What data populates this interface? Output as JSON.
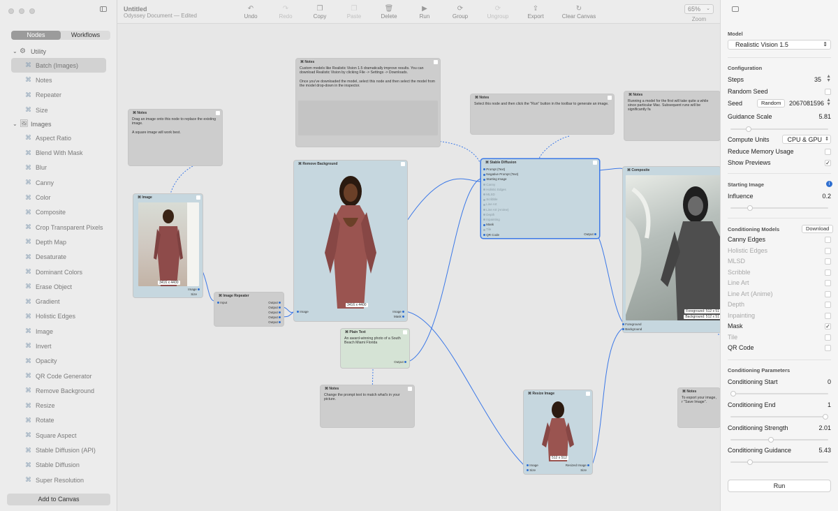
{
  "window": {
    "title": "Untitled",
    "subtitle": "Odyssey Document — Edited"
  },
  "sidebar": {
    "tabs": [
      "Nodes",
      "Workflows"
    ],
    "groups": [
      {
        "label": "Utility",
        "items": [
          "Batch (Images)",
          "Notes",
          "Repeater",
          "Size"
        ]
      },
      {
        "label": "Images",
        "items": [
          "Aspect Ratio",
          "Blend With Mask",
          "Blur",
          "Canny",
          "Color",
          "Composite",
          "Crop Transparent Pixels",
          "Depth Map",
          "Desaturate",
          "Dominant Colors",
          "Erase Object",
          "Gradient",
          "Holistic Edges",
          "Image",
          "Invert",
          "Opacity",
          "QR Code Generator",
          "Remove Background",
          "Resize",
          "Rotate",
          "Square Aspect",
          "Stable Diffusion (API)",
          "Stable Diffusion",
          "Super Resolution"
        ]
      }
    ],
    "add_button": "Add to Canvas"
  },
  "toolbar": {
    "undo": "Undo",
    "redo": "Redo",
    "copy": "Copy",
    "paste": "Paste",
    "delete": "Delete",
    "run": "Run",
    "group": "Group",
    "ungroup": "Ungroup",
    "export": "Export",
    "clear": "Clear Canvas",
    "zoom_value": "65%",
    "zoom_label": "Zoom"
  },
  "canvas": {
    "note1": {
      "title": "Notes",
      "text": "Drag an image onto this node to replace the existing image.\n\nA square image will work best."
    },
    "note2": {
      "title": "Notes",
      "text": "Custom models like Realistic Vision 1.5 dramatically improve results. You can download Realistic Vision by clicking File -> Settings -> Downloads.\n\nOnce you've downloaded the model, select this node and then select the model from the model drop-down in the inspector."
    },
    "note3": {
      "title": "Notes",
      "text": "Select this node and then click the \"Run\" button in the toolbar to generate an image."
    },
    "note4": {
      "title": "Notes",
      "text": "Running a model for the first will take quite a while since particular Mac. Subsequent runs will be significantly fa"
    },
    "note5": {
      "title": "Notes",
      "text": "Change the prompt text to match what's in your picture."
    },
    "note6": {
      "title": "Notes",
      "text": "To export your image, r \"Save Image\"."
    },
    "image_node": {
      "title": "Image",
      "dims": "3416 x 4400",
      "ports": [
        "Image",
        "Size"
      ]
    },
    "repeater": {
      "title": "Image Repeater",
      "input": "Input",
      "outputs": [
        "Output",
        "Output",
        "Output",
        "Output",
        "Output"
      ]
    },
    "remove_bg": {
      "title": "Remove Background",
      "dims": "3416 x 4400",
      "in": "Image",
      "outs": [
        "Image",
        "Mask"
      ]
    },
    "plain_text": {
      "title": "Plain Text",
      "text": "An award-winning photo of a South Beach Miami Florida",
      "out": "Output"
    },
    "stable_diffusion": {
      "title": "Stable Diffusion",
      "inputs": [
        "Prompt (Text)",
        "Negative Prompt (Text)",
        "Starting Image",
        "Canny",
        "Holistic Edges",
        "MLSD",
        "Scribble",
        "Line Art",
        "Line Art (Anime)",
        "Depth",
        "Inpainting",
        "Mask",
        "Tile",
        "QR Code"
      ],
      "active": [
        true,
        true,
        true,
        false,
        false,
        false,
        false,
        false,
        false,
        false,
        false,
        true,
        false,
        true
      ],
      "out": "Output"
    },
    "composite": {
      "title": "Composite",
      "fg": "Foreground: 512 x 51",
      "bg": "Background: 512 x 51",
      "ports": [
        "Foreground",
        "Background"
      ]
    },
    "resize": {
      "title": "Resize Image",
      "dims": "512 x 512",
      "in": [
        "Image",
        "Size"
      ],
      "out": "Resized Image"
    }
  },
  "inspector": {
    "model_label": "Model",
    "model_value": "Realistic Vision 1.5",
    "config_label": "Configuration",
    "steps": {
      "label": "Steps",
      "value": "35"
    },
    "random_seed": {
      "label": "Random Seed",
      "checked": false
    },
    "seed": {
      "label": "Seed",
      "button": "Random",
      "value": "2067081596"
    },
    "guidance": {
      "label": "Guidance Scale",
      "value": "5.81"
    },
    "compute": {
      "label": "Compute Units",
      "value": "CPU & GPU"
    },
    "reduce_mem": {
      "label": "Reduce Memory Usage",
      "checked": false
    },
    "previews": {
      "label": "Show Previews",
      "checked": true
    },
    "starting_label": "Starting Image",
    "influence": {
      "label": "Influence",
      "value": "0.2"
    },
    "cond_models_label": "Conditioning Models",
    "download": "Download",
    "cond_models": [
      {
        "label": "Canny Edges",
        "enabled": true,
        "checked": false
      },
      {
        "label": "Holistic Edges",
        "enabled": false,
        "checked": false
      },
      {
        "label": "MLSD",
        "enabled": false,
        "checked": false
      },
      {
        "label": "Scribble",
        "enabled": false,
        "checked": false
      },
      {
        "label": "Line Art",
        "enabled": false,
        "checked": false
      },
      {
        "label": "Line Art (Anime)",
        "enabled": false,
        "checked": false
      },
      {
        "label": "Depth",
        "enabled": false,
        "checked": false
      },
      {
        "label": "Inpainting",
        "enabled": false,
        "checked": false
      },
      {
        "label": "Mask",
        "enabled": true,
        "checked": true
      },
      {
        "label": "Tile",
        "enabled": false,
        "checked": false
      },
      {
        "label": "QR Code",
        "enabled": true,
        "checked": false
      }
    ],
    "cond_params_label": "Conditioning Parameters",
    "cond_start": {
      "label": "Conditioning Start",
      "value": "0"
    },
    "cond_end": {
      "label": "Conditioning End",
      "value": "1"
    },
    "cond_strength": {
      "label": "Conditioning Strength",
      "value": "2.01"
    },
    "cond_guidance": {
      "label": "Conditioning Guidance",
      "value": "5.43"
    },
    "run": "Run"
  },
  "colors": {
    "accent": "#2f6fd0",
    "node_blue": "#c6d7df",
    "node_grey": "#cdcdcd",
    "node_green": "#d5e3d5"
  }
}
